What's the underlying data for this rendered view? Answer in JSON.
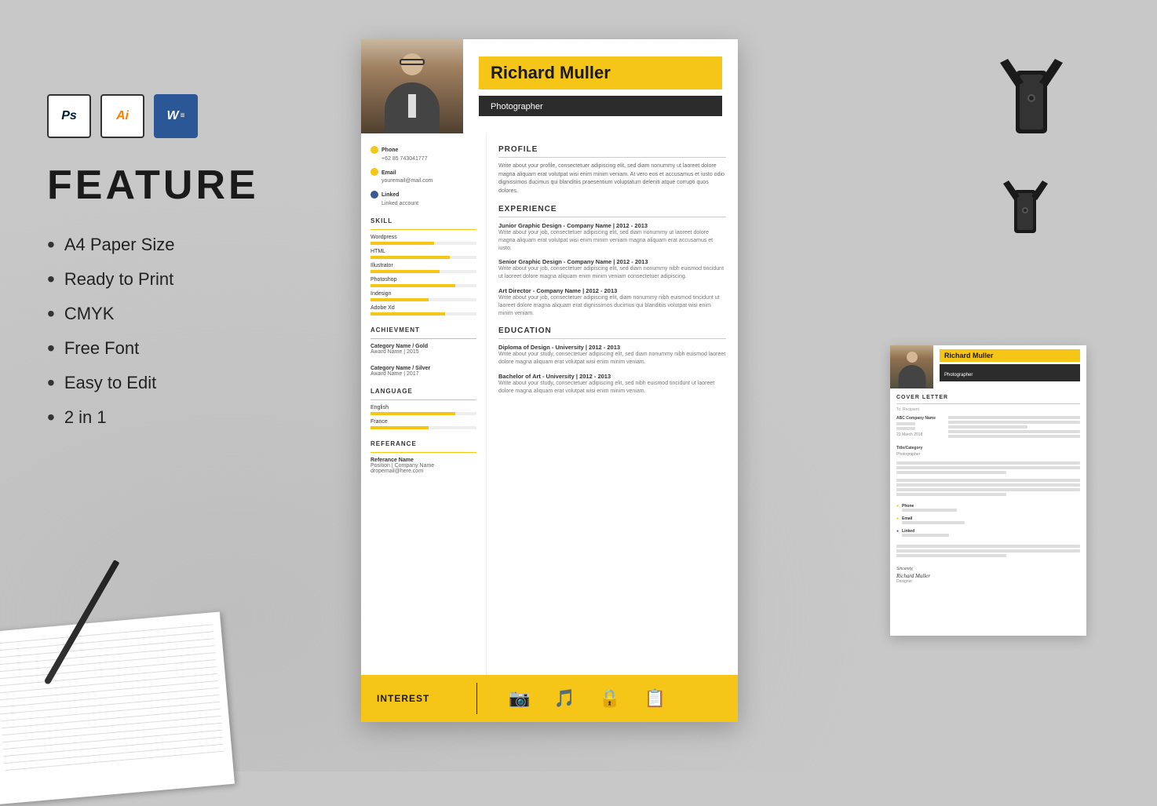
{
  "software_icons": [
    {
      "label": "Ps",
      "type": "ps"
    },
    {
      "label": "Ai",
      "type": "ai"
    },
    {
      "label": "W",
      "type": "w"
    }
  ],
  "feature_section": {
    "title": "FEATURE",
    "items": [
      "A4 Paper Size",
      "Ready to Print",
      "CMYK",
      "Free Font",
      "Easy to Edit",
      "2 in 1"
    ]
  },
  "resume": {
    "name": "Richard Muller",
    "title": "Photographer",
    "contact": {
      "phone_label": "Phone",
      "phone": "+62 85 743041777",
      "email_label": "Email",
      "email": "youremail@mail.com",
      "linked_label": "Linked",
      "linked": "Linked account"
    },
    "skills": [
      {
        "name": "Wordpress",
        "level": 60
      },
      {
        "name": "HTML",
        "level": 75
      },
      {
        "name": "Illustrator",
        "level": 65
      },
      {
        "name": "Photoshop",
        "level": 80
      },
      {
        "name": "Indesign",
        "level": 55
      },
      {
        "name": "Adobe Xd",
        "level": 70
      }
    ],
    "achievements": [
      {
        "category": "Category Name / Gold",
        "name": "Award Name | 2015"
      },
      {
        "category": "Category Name / Silver",
        "name": "Award Name | 2017"
      }
    ],
    "languages": [
      {
        "name": "English",
        "level": 80
      },
      {
        "name": "France",
        "level": 55
      }
    ],
    "reference": {
      "name": "Referance Name",
      "position": "Position | Company Name",
      "email": "dropemail@here.com"
    },
    "profile_text": "Write about your profile, consectetuer adipiscing elit, sed diam nonummy ut laoreet dolore magna aliquam erat volutpat wisi enim minim veniam. At vero eos et accusamus et iusto odio dignissimos ducimus qui blanditiis praesentium voluptatum deleniti atque corrupti quos dolores.",
    "experience": [
      {
        "title": "Junior Graphic Design - Company Name | 2012 - 2013",
        "desc": "Write about your job, consectetuer adipiscing elit, sed diam nonummy ut laoreet dolore magna aliquam erat volutpat wisi enim minim veniam magna aliquam erat accusamus et iusto."
      },
      {
        "title": "Senior Graphic Design - Company Name | 2012 - 2013",
        "desc": "Write about your job, consectetuer adipiscing elit, sed diam nonummy nibh euismod tincidunt ut laoreet dolore magna aliquam enim minim veniam consectetuer adipiscing."
      },
      {
        "title": "Art Director - Company Name | 2012 - 2013",
        "desc": "Write about your job, consectetuer adipiscing elit, diam nonummy nibh euismod tincidunt ut laoreet dolore magna aliquam erat dignissimos ducimus qui blanditiis volutpat wisi enim minim veniam."
      }
    ],
    "education": [
      {
        "title": "Diploma of Design - University | 2012 - 2013",
        "desc": "Write about your study, consectetuer adipiscing elit, sed diam nonummy nibh euismod laoreet dolore magna aliquam erat volutpat wisi enim minim veniam."
      },
      {
        "title": "Bachelor of Art - University | 2012 - 2013",
        "desc": "Write about your study, consectetuer adipiscing elit, sed nibh euismod tincidunt ut laoreet dolore magna aliquam erat volutpat wisi enim minim veniam."
      }
    ],
    "interest_label": "INTEREST",
    "interest_icons": [
      "📷",
      "🎵",
      "🔒",
      "📋"
    ]
  },
  "cover_letter": {
    "name": "Richard Muller",
    "subtitle": "Photographer",
    "section_title": "COVER LETTER"
  },
  "colors": {
    "accent": "#f5c518",
    "dark": "#2c2c2c",
    "text": "#333333",
    "light_text": "#777777"
  }
}
